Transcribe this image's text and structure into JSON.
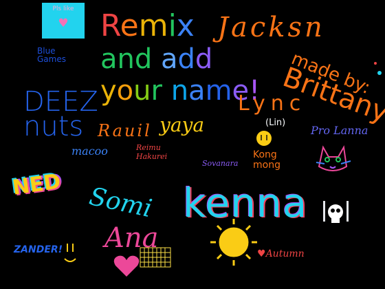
{
  "colors": {
    "background": "#000000",
    "like_button": "#22d3ee",
    "heart": "#f472b6",
    "sun": "#facc15"
  },
  "like_button": {
    "label": "Pls like",
    "icon": "heart-icon"
  },
  "headline": {
    "line1": "Remix",
    "line2": "and add",
    "line3": "your name!"
  },
  "signatures": {
    "jackson": "Jacksn",
    "made_by": "made by:",
    "brittany": "Brittany",
    "blue_games": "Blue Games",
    "deez_nuts": "DEEZ nuts",
    "lync": "Lync",
    "lynx_note": "(Lin)",
    "pro_lanna": "Pro Lanna",
    "rauil": "Rauil",
    "yaya": "yaya",
    "macoo": "macoo",
    "reimu": "Reimu Hakurei",
    "sovanara": "Sovanara",
    "kong_mong": "Kong mong",
    "ned": "NED",
    "somi": "Somi",
    "kenna": "kenna",
    "ana": "Ana",
    "zander": "ZANDER!",
    "autumn": "Autumn"
  },
  "icons": [
    "heart-icon",
    "smiley-icon",
    "cat-icon",
    "sun-icon",
    "skull-icon"
  ]
}
